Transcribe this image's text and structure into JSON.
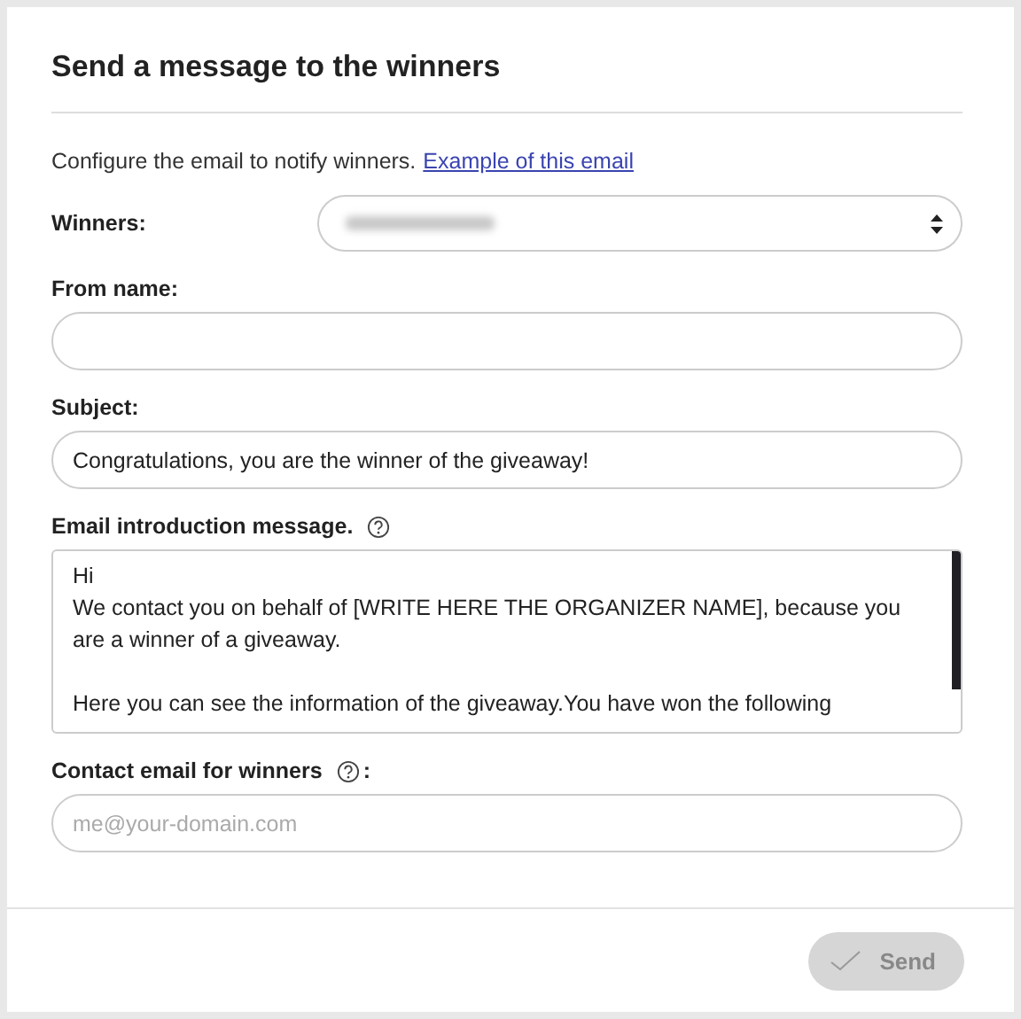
{
  "title": "Send a message to the winners",
  "intro": {
    "text": "Configure the email to notify winners.",
    "link": "Example of this email"
  },
  "winners": {
    "label": "Winners:",
    "redacted": true
  },
  "from_name": {
    "label": "From name:"
  },
  "subject": {
    "label": "Subject:",
    "value": "Congratulations, you are the winner of the giveaway!"
  },
  "message": {
    "label": "Email introduction message.",
    "help": true,
    "paragraphs": [
      [
        "Hi",
        "We contact you on behalf of [WRITE HERE THE ORGANIZER NAME], because you are a winner of a giveaway."
      ],
      [
        "Here you can see the information of the giveaway.You have won the following"
      ]
    ]
  },
  "contact": {
    "label": "Contact email for winners",
    "help": true,
    "suffix": ":",
    "placeholder": "me@your-domain.com"
  },
  "send": {
    "label": "Send",
    "disabled": true
  }
}
